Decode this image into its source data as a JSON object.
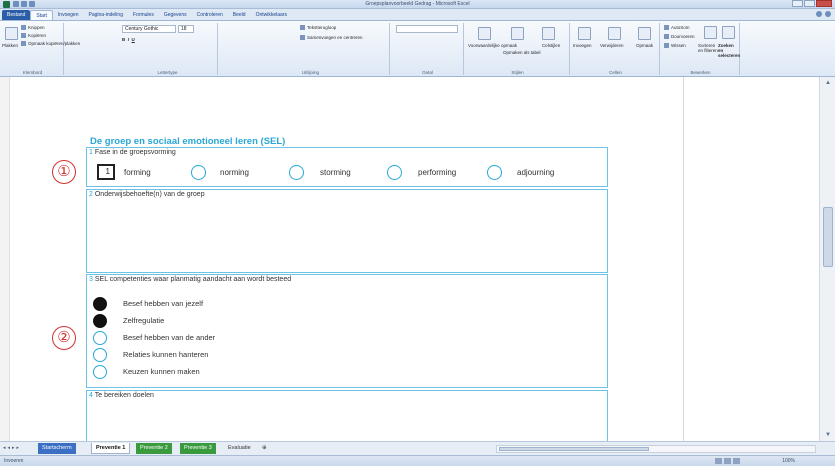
{
  "window": {
    "title": "Groepsplanvoorbeeld Gedrag - Microsoft Excel"
  },
  "ribbon": {
    "tabs": [
      "Bestand",
      "Start",
      "Invoegen",
      "Pagina-indeling",
      "Formules",
      "Gegevens",
      "Controleren",
      "Beeld",
      "Ontwikkelaars"
    ],
    "clipboard": {
      "plakken": "Plakken",
      "knippen": "Knippen",
      "kopieren": "Kopiëren",
      "opmaak": "Opmaak kopiëren/plakken",
      "label": "Klembord"
    },
    "font": {
      "name": "Century Gothic",
      "size": "18",
      "label": "Lettertype"
    },
    "alignment": {
      "wrap": "Tekstterugloop",
      "merge": "Samenvoegen en centreren",
      "label": "Uitlijning"
    },
    "number": {
      "label": "Getal"
    },
    "styles": {
      "conditional": "Voorwaardelijke opmaak",
      "table": "Opmaken als tabel",
      "cell": "Celstijlen",
      "label": "Stijlen"
    },
    "cells": {
      "insert": "Invoegen",
      "delete": "Verwijderen",
      "format": "Opmaak",
      "label": "Cellen"
    },
    "editing": {
      "autosum": "AutoSom",
      "fill": "Doorvoeren",
      "clear": "Wissen",
      "sort": "Sorteren en filteren",
      "find": "Zoeken en selecteren",
      "label": "Bewerken"
    }
  },
  "worksheet": {
    "title": "De groep en sociaal emotioneel leren (SEL)",
    "section1": {
      "num": "1",
      "label": "Fase in de groepsvorming",
      "input_value": "1",
      "phases": [
        "forming",
        "norming",
        "storming",
        "performing",
        "adjourning"
      ]
    },
    "section2": {
      "num": "2",
      "label": "Onderwijsbehoefte(n) van de groep"
    },
    "section3": {
      "num": "3",
      "label": "SEL competenties waar planmatig aandacht aan wordt besteed",
      "items": [
        {
          "label": "Besef hebben van jezelf",
          "checked": true
        },
        {
          "label": "Zelfregulatie",
          "checked": true
        },
        {
          "label": "Besef hebben van de ander",
          "checked": false
        },
        {
          "label": "Relaties kunnen hanteren",
          "checked": false
        },
        {
          "label": "Keuzen kunnen maken",
          "checked": false
        }
      ]
    },
    "section4": {
      "num": "4",
      "label": "Te bereiken doelen"
    },
    "markers": [
      "①",
      "②"
    ]
  },
  "sheet_tabs": [
    "Startscherm",
    "Preventie 1",
    "Preventie 2",
    "Preventie 3",
    "Evaluatie"
  ],
  "status": {
    "mode": "Invoeren",
    "zoom": "100%"
  },
  "colors": {
    "accent": "#29a8d6",
    "marker": "#d63030"
  }
}
